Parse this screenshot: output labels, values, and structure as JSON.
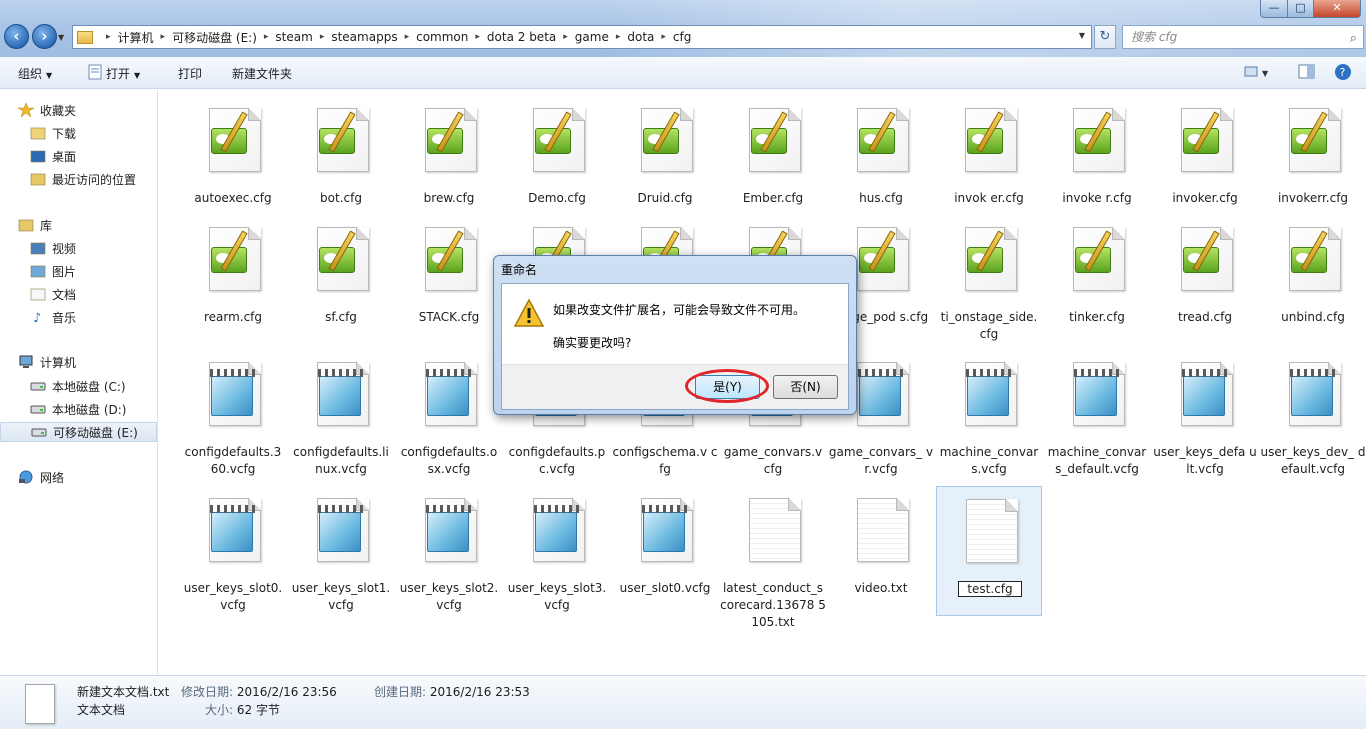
{
  "nav": {
    "back": "back",
    "forward": "forward"
  },
  "address": {
    "breadcrumbs": [
      "计算机",
      "可移动磁盘 (E:)",
      "steam",
      "steamapps",
      "common",
      "dota 2 beta",
      "game",
      "dota",
      "cfg"
    ]
  },
  "search": {
    "placeholder": "搜索 cfg"
  },
  "window_buttons": {
    "minimize": "—",
    "maximize": "□",
    "close": "✕"
  },
  "toolbar": {
    "organize": "组织",
    "open": "打开",
    "print": "打印",
    "new_folder": "新建文件夹"
  },
  "sidebar": {
    "favorites": {
      "label": "收藏夹",
      "items": [
        "下载",
        "桌面",
        "最近访问的位置"
      ]
    },
    "libraries": {
      "label": "库",
      "items": [
        "视频",
        "图片",
        "文档",
        "音乐"
      ]
    },
    "computer": {
      "label": "计算机",
      "items": [
        "本地磁盘 (C:)",
        "本地磁盘 (D:)",
        "可移动磁盘 (E:)"
      ]
    },
    "network": {
      "label": "网络"
    }
  },
  "files": [
    {
      "name": "autoexec.cfg",
      "icon": "notepad-plus"
    },
    {
      "name": "bot.cfg",
      "icon": "notepad-plus"
    },
    {
      "name": "brew.cfg",
      "icon": "notepad-plus"
    },
    {
      "name": "Demo.cfg",
      "icon": "notepad-plus"
    },
    {
      "name": "Druid.cfg",
      "icon": "notepad-plus"
    },
    {
      "name": "Ember.cfg",
      "icon": "notepad-plus"
    },
    {
      "name": "hus.cfg",
      "icon": "notepad-plus"
    },
    {
      "name": "invok er.cfg",
      "icon": "notepad-plus"
    },
    {
      "name": "invoke r.cfg",
      "icon": "notepad-plus"
    },
    {
      "name": "invoker.cfg",
      "icon": "notepad-plus"
    },
    {
      "name": "invokerr.cfg",
      "icon": "notepad-plus"
    },
    {
      "name": "rearm.cfg",
      "icon": "notepad-plus"
    },
    {
      "name": "sf.cfg",
      "icon": "notepad-plus"
    },
    {
      "name": "STACK.cfg",
      "icon": "notepad-plus"
    },
    {
      "name": "",
      "icon": "notepad-plus"
    },
    {
      "name": "",
      "icon": "notepad-plus"
    },
    {
      "name": "",
      "icon": "notepad-plus"
    },
    {
      "name": "stage_pod s.cfg",
      "icon": "notepad-plus"
    },
    {
      "name": "ti_onstage_side. cfg",
      "icon": "notepad-plus"
    },
    {
      "name": "tinker.cfg",
      "icon": "notepad-plus"
    },
    {
      "name": "tread.cfg",
      "icon": "notepad-plus"
    },
    {
      "name": "unbind.cfg",
      "icon": "notepad-plus"
    },
    {
      "name": "configdefaults.3 60.vcfg",
      "icon": "notepad"
    },
    {
      "name": "configdefaults.li nux.vcfg",
      "icon": "notepad"
    },
    {
      "name": "configdefaults.o sx.vcfg",
      "icon": "notepad"
    },
    {
      "name": "configdefaults.p c.vcfg",
      "icon": "notepad"
    },
    {
      "name": "configschema.v cfg",
      "icon": "notepad"
    },
    {
      "name": "game_convars.v cfg",
      "icon": "notepad"
    },
    {
      "name": "game_convars_ vr.vcfg",
      "icon": "notepad"
    },
    {
      "name": "machine_convar s.vcfg",
      "icon": "notepad"
    },
    {
      "name": "machine_convar s_default.vcfg",
      "icon": "notepad"
    },
    {
      "name": "user_keys_defa ult.vcfg",
      "icon": "notepad"
    },
    {
      "name": "user_keys_dev_ default.vcfg",
      "icon": "notepad"
    },
    {
      "name": "user_keys_slot0. vcfg",
      "icon": "notepad"
    },
    {
      "name": "user_keys_slot1. vcfg",
      "icon": "notepad"
    },
    {
      "name": "user_keys_slot2. vcfg",
      "icon": "notepad"
    },
    {
      "name": "user_keys_slot3. vcfg",
      "icon": "notepad"
    },
    {
      "name": "user_slot0.vcfg",
      "icon": "notepad"
    },
    {
      "name": "latest_conduct_s corecard.13678 5105.txt",
      "icon": "text"
    },
    {
      "name": "video.txt",
      "icon": "text"
    },
    {
      "name": "test.cfg",
      "icon": "text",
      "selected": true
    }
  ],
  "dialog": {
    "title": "重命名",
    "message": "如果改变文件扩展名，可能会导致文件不可用。",
    "question": "确实要更改吗?",
    "yes": "是(Y)",
    "no": "否(N)"
  },
  "details": {
    "filename": "新建文本文档.txt",
    "modified_label": "修改日期:",
    "modified": "2016/2/16 23:56",
    "created_label": "创建日期:",
    "created": "2016/2/16 23:53",
    "type": "文本文档",
    "size_label": "大小:",
    "size": "62 字节"
  }
}
